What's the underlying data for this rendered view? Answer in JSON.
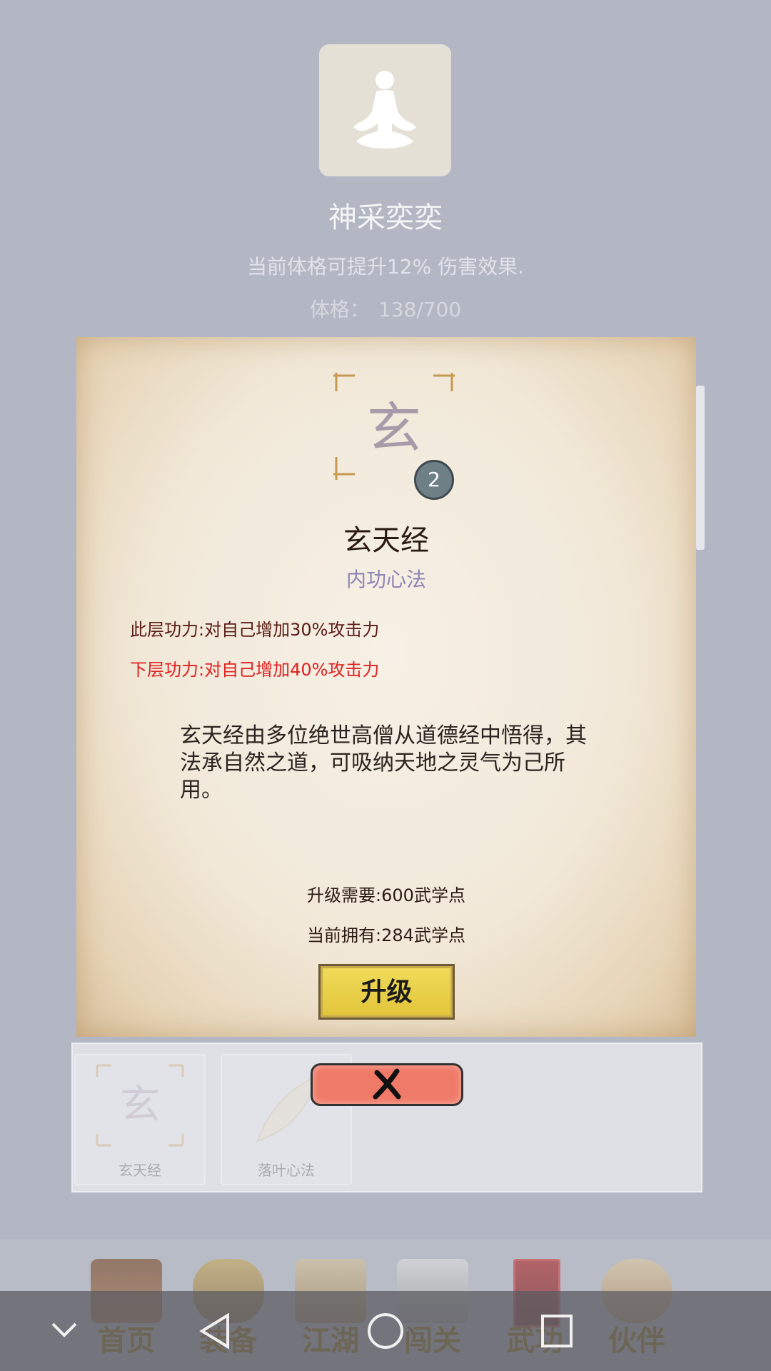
{
  "header": {
    "avatar_icon": "meditation-figure-icon",
    "title": "神采奕奕",
    "description": "当前体格可提升12% 伤害效果.",
    "stat_label": "体格：",
    "stat_value": "138/700"
  },
  "modal": {
    "glyph": "玄",
    "level": "2",
    "skill_name": "玄天经",
    "skill_type": "内功心法",
    "current_power": "此层功力:对自己增加30%攻击力",
    "next_power": "下层功力:对自己增加40%攻击力",
    "lore": "玄天经由多位绝世高僧从道德经中悟得，其法承自然之道，可吸纳天地之灵气为己所用。",
    "upgrade_cost": "升级需要:600武学点",
    "current_points": "当前拥有:284武学点",
    "upgrade_label": "升级",
    "close_icon": "close-x-icon"
  },
  "skills": [
    {
      "label": "玄天经",
      "icon": "xuan-glyph-icon"
    },
    {
      "label": "落叶心法",
      "icon": "feather-icon"
    }
  ],
  "game_nav": [
    {
      "label": "首页",
      "icon": "pavilion-icon"
    },
    {
      "label": "装备",
      "icon": "armor-icon"
    },
    {
      "label": "江湖",
      "icon": "scroll-map-icon"
    },
    {
      "label": "闯关",
      "icon": "crossed-swords-icon"
    },
    {
      "label": "武功",
      "icon": "manual-book-icon"
    },
    {
      "label": "伙伴",
      "icon": "companions-icon"
    }
  ],
  "system_nav": {
    "collapse_icon": "chevron-down-icon",
    "back_icon": "back-triangle-icon",
    "home_icon": "home-circle-icon",
    "recent_icon": "recent-square-icon"
  }
}
